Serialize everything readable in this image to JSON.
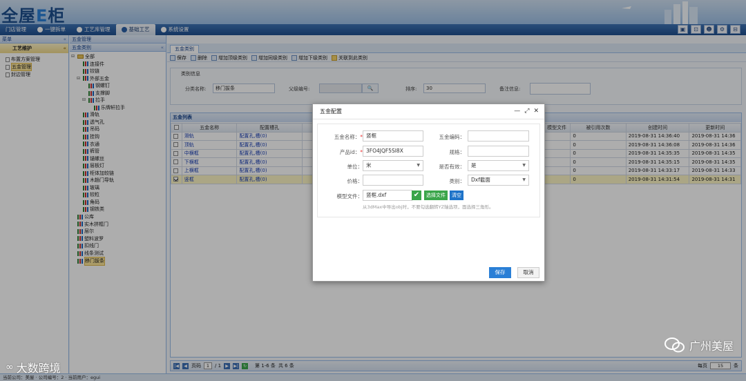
{
  "app": {
    "logo_pre": "全屋",
    "logo_e": "E",
    "logo_post": "柜"
  },
  "nav": [
    {
      "label": "门店管理"
    },
    {
      "label": "一键拆单"
    },
    {
      "label": "工艺库管理"
    },
    {
      "label": "基础工艺"
    },
    {
      "label": "系统设置"
    }
  ],
  "left": {
    "menu_title": "菜单",
    "section": "工艺维护",
    "items": [
      "布置方案管理",
      "五金管理",
      "封边管理"
    ]
  },
  "mid": {
    "title": "五金类别"
  },
  "breadcrumb": "五金管理",
  "tab": "五金类别",
  "toolbar": [
    "保存",
    "删除",
    "增加顶级类别",
    "增加同级类别",
    "增加下级类别",
    "关联到此类别"
  ],
  "category": {
    "legend": "类别信息",
    "name_label": "分类名称:",
    "name_value": "移门拔条",
    "parent_label": "父级编号:",
    "sort_label": "排序:",
    "sort_value": "30",
    "remark_label": "备注信息:"
  },
  "tree": [
    {
      "t": "全部",
      "d": 0,
      "f": 1,
      "tg": "⊟"
    },
    {
      "t": "连接件",
      "d": 1
    },
    {
      "t": "铰链",
      "d": 1
    },
    {
      "t": "外部五金",
      "d": 1,
      "tg": "⊟"
    },
    {
      "t": "钢螺钉",
      "d": 2
    },
    {
      "t": "支撑脚",
      "d": 2
    },
    {
      "t": "拉手",
      "d": 2,
      "tg": "⊟"
    },
    {
      "t": "乐牌轩拉手",
      "d": 3
    },
    {
      "t": "滑轨",
      "d": 1
    },
    {
      "t": "透气孔",
      "d": 1
    },
    {
      "t": "吊码",
      "d": 1
    },
    {
      "t": "挂钩",
      "d": 1
    },
    {
      "t": "衣通",
      "d": 1
    },
    {
      "t": "裤管",
      "d": 1
    },
    {
      "t": "锚螺丝",
      "d": 1
    },
    {
      "t": "层板灯",
      "d": 1
    },
    {
      "t": "柜体加较链",
      "d": 1
    },
    {
      "t": "木趟门导轨",
      "d": 1
    },
    {
      "t": "玻璃",
      "d": 1
    },
    {
      "t": "较粒",
      "d": 1
    },
    {
      "t": "角码",
      "d": 1
    },
    {
      "t": "钢铁类",
      "d": 1
    },
    {
      "t": "公库",
      "d": 0
    },
    {
      "t": "实木拼框门",
      "d": 0
    },
    {
      "t": "层尔",
      "d": 0
    },
    {
      "t": "塑料波罗",
      "d": 0
    },
    {
      "t": "扣线门",
      "d": 0
    },
    {
      "t": "线条测试",
      "d": 0
    },
    {
      "t": "移门拔条",
      "d": 0,
      "sel": 1
    }
  ],
  "grid": {
    "title": "五金列表",
    "headers": [
      "",
      "五金名称",
      "配置槽孔",
      "",
      "模型文件",
      "被引用次数",
      "创建时间",
      "更新时间"
    ],
    "rows": [
      {
        "name": "滑轨",
        "cfg": "配置孔,槽(0)",
        "refs": "0",
        "created": "2019-08-31 14:36:40",
        "updated": "2019-08-31 14:36"
      },
      {
        "name": "顶轨",
        "cfg": "配置孔,槽(0)",
        "refs": "0",
        "created": "2019-08-31 14:36:08",
        "updated": "2019-08-31 14:36"
      },
      {
        "name": "中横框",
        "cfg": "配置孔,槽(0)",
        "refs": "0",
        "created": "2019-08-31 14:35:35",
        "updated": "2019-08-31 14:35"
      },
      {
        "name": "下横框",
        "cfg": "配置孔,槽(0)",
        "refs": "0",
        "created": "2019-08-31 14:35:15",
        "updated": "2019-08-31 14:35"
      },
      {
        "name": "上横框",
        "cfg": "配置孔,槽(0)",
        "refs": "0",
        "created": "2019-08-31 14:33:17",
        "updated": "2019-08-31 14:33"
      },
      {
        "name": "竖框",
        "cfg": "配置孔,槽(0)",
        "refs": "0",
        "created": "2019-08-31 14:31:54",
        "updated": "2019-08-31 14:31",
        "sel": 1
      }
    ]
  },
  "pager": {
    "page_label": "页码",
    "page": "1",
    "of": "/ 1",
    "range": "第 1-6 条",
    "total": "共 6 条",
    "per_label": "每页",
    "per": "15",
    "suffix": "条"
  },
  "status": "当前公司：美屋 · 公司编号：2 · 当前用户：egui",
  "dialog": {
    "title": "五金配置",
    "name_label": "五金名称：",
    "name_value": "竖框",
    "code_label": "五金编码：",
    "pid_label": "产品id：",
    "pid_value": "3FO4JQF5SI8X",
    "spec_label": "规格：",
    "unit_label": "单位：",
    "unit_value": "米",
    "valid_label": "是否有效：",
    "valid_value": "是",
    "price_label": "价格：",
    "type_label": "类别：",
    "type_value": "Dxf截面",
    "model_label": "模型文件：",
    "model_value": "竖框.dxf",
    "choose": "选择文件",
    "clear": "清空",
    "hint": "从3dMax中导出obj时，不要勾选翻转YZ轴选项，面选择三角形。",
    "save": "保存",
    "cancel": "取消"
  },
  "watermark": {
    "right": "广州美屋",
    "left": "大数跨境"
  },
  "colors": {
    "nav_bg": "#1f4f8f",
    "accent": "#2a7fd6",
    "select_row": "#fcf5c5",
    "ok": "#3aa54a"
  }
}
